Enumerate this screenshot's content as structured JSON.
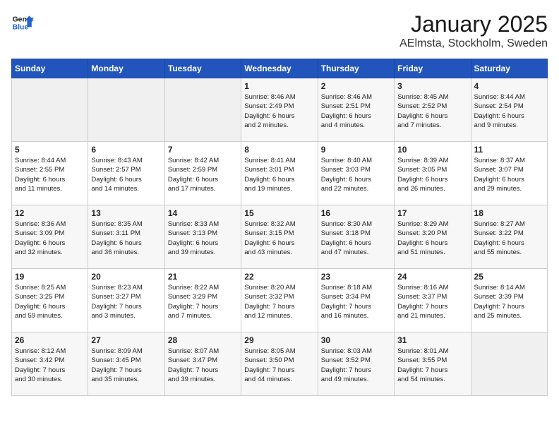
{
  "header": {
    "logo_line1": "General",
    "logo_line2": "Blue",
    "title": "January 2025",
    "subtitle": "AElmsta, Stockholm, Sweden"
  },
  "days_of_week": [
    "Sunday",
    "Monday",
    "Tuesday",
    "Wednesday",
    "Thursday",
    "Friday",
    "Saturday"
  ],
  "weeks": [
    [
      {
        "num": "",
        "info": ""
      },
      {
        "num": "",
        "info": ""
      },
      {
        "num": "",
        "info": ""
      },
      {
        "num": "1",
        "info": "Sunrise: 8:46 AM\nSunset: 2:49 PM\nDaylight: 6 hours\nand 2 minutes."
      },
      {
        "num": "2",
        "info": "Sunrise: 8:46 AM\nSunset: 2:51 PM\nDaylight: 6 hours\nand 4 minutes."
      },
      {
        "num": "3",
        "info": "Sunrise: 8:45 AM\nSunset: 2:52 PM\nDaylight: 6 hours\nand 7 minutes."
      },
      {
        "num": "4",
        "info": "Sunrise: 8:44 AM\nSunset: 2:54 PM\nDaylight: 6 hours\nand 9 minutes."
      }
    ],
    [
      {
        "num": "5",
        "info": "Sunrise: 8:44 AM\nSunset: 2:55 PM\nDaylight: 6 hours\nand 11 minutes."
      },
      {
        "num": "6",
        "info": "Sunrise: 8:43 AM\nSunset: 2:57 PM\nDaylight: 6 hours\nand 14 minutes."
      },
      {
        "num": "7",
        "info": "Sunrise: 8:42 AM\nSunset: 2:59 PM\nDaylight: 6 hours\nand 17 minutes."
      },
      {
        "num": "8",
        "info": "Sunrise: 8:41 AM\nSunset: 3:01 PM\nDaylight: 6 hours\nand 19 minutes."
      },
      {
        "num": "9",
        "info": "Sunrise: 8:40 AM\nSunset: 3:03 PM\nDaylight: 6 hours\nand 22 minutes."
      },
      {
        "num": "10",
        "info": "Sunrise: 8:39 AM\nSunset: 3:05 PM\nDaylight: 6 hours\nand 26 minutes."
      },
      {
        "num": "11",
        "info": "Sunrise: 8:37 AM\nSunset: 3:07 PM\nDaylight: 6 hours\nand 29 minutes."
      }
    ],
    [
      {
        "num": "12",
        "info": "Sunrise: 8:36 AM\nSunset: 3:09 PM\nDaylight: 6 hours\nand 32 minutes."
      },
      {
        "num": "13",
        "info": "Sunrise: 8:35 AM\nSunset: 3:11 PM\nDaylight: 6 hours\nand 36 minutes."
      },
      {
        "num": "14",
        "info": "Sunrise: 8:33 AM\nSunset: 3:13 PM\nDaylight: 6 hours\nand 39 minutes."
      },
      {
        "num": "15",
        "info": "Sunrise: 8:32 AM\nSunset: 3:15 PM\nDaylight: 6 hours\nand 43 minutes."
      },
      {
        "num": "16",
        "info": "Sunrise: 8:30 AM\nSunset: 3:18 PM\nDaylight: 6 hours\nand 47 minutes."
      },
      {
        "num": "17",
        "info": "Sunrise: 8:29 AM\nSunset: 3:20 PM\nDaylight: 6 hours\nand 51 minutes."
      },
      {
        "num": "18",
        "info": "Sunrise: 8:27 AM\nSunset: 3:22 PM\nDaylight: 6 hours\nand 55 minutes."
      }
    ],
    [
      {
        "num": "19",
        "info": "Sunrise: 8:25 AM\nSunset: 3:25 PM\nDaylight: 6 hours\nand 59 minutes."
      },
      {
        "num": "20",
        "info": "Sunrise: 8:23 AM\nSunset: 3:27 PM\nDaylight: 7 hours\nand 3 minutes."
      },
      {
        "num": "21",
        "info": "Sunrise: 8:22 AM\nSunset: 3:29 PM\nDaylight: 7 hours\nand 7 minutes."
      },
      {
        "num": "22",
        "info": "Sunrise: 8:20 AM\nSunset: 3:32 PM\nDaylight: 7 hours\nand 12 minutes."
      },
      {
        "num": "23",
        "info": "Sunrise: 8:18 AM\nSunset: 3:34 PM\nDaylight: 7 hours\nand 16 minutes."
      },
      {
        "num": "24",
        "info": "Sunrise: 8:16 AM\nSunset: 3:37 PM\nDaylight: 7 hours\nand 21 minutes."
      },
      {
        "num": "25",
        "info": "Sunrise: 8:14 AM\nSunset: 3:39 PM\nDaylight: 7 hours\nand 25 minutes."
      }
    ],
    [
      {
        "num": "26",
        "info": "Sunrise: 8:12 AM\nSunset: 3:42 PM\nDaylight: 7 hours\nand 30 minutes."
      },
      {
        "num": "27",
        "info": "Sunrise: 8:09 AM\nSunset: 3:45 PM\nDaylight: 7 hours\nand 35 minutes."
      },
      {
        "num": "28",
        "info": "Sunrise: 8:07 AM\nSunset: 3:47 PM\nDaylight: 7 hours\nand 39 minutes."
      },
      {
        "num": "29",
        "info": "Sunrise: 8:05 AM\nSunset: 3:50 PM\nDaylight: 7 hours\nand 44 minutes."
      },
      {
        "num": "30",
        "info": "Sunrise: 8:03 AM\nSunset: 3:52 PM\nDaylight: 7 hours\nand 49 minutes."
      },
      {
        "num": "31",
        "info": "Sunrise: 8:01 AM\nSunset: 3:55 PM\nDaylight: 7 hours\nand 54 minutes."
      },
      {
        "num": "",
        "info": ""
      }
    ]
  ]
}
